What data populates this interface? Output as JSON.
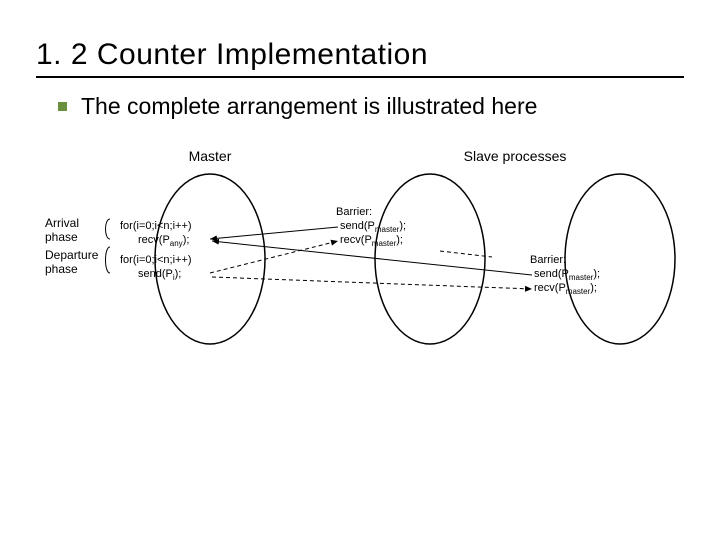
{
  "title": "1. 2 Counter Implementation",
  "bullet_text": "The complete arrangement is illustrated here",
  "diagram": {
    "master_label": "Master",
    "slave_label": "Slave processes",
    "arrival_label": "Arrival",
    "phase_label_1": "phase",
    "departure_label": "Departure",
    "phase_label_2": "phase",
    "master_code": {
      "line1_a": "for(i=0;i<n;i++)",
      "line1_b_recv": "recv(P",
      "line1_b_sub": "any",
      "line1_b_end": ");",
      "line2_a": "for(i=0;i<n;i++)",
      "line2_b_send": "send(P",
      "line2_b_sub": "i",
      "line2_b_end": ");"
    },
    "barrier_label": "Barrier:",
    "barrier_send": "send(P",
    "barrier_send_sub": "master",
    "barrier_send_end": ");",
    "barrier_recv": "recv(P",
    "barrier_recv_sub": "master",
    "barrier_recv_end": ");"
  }
}
